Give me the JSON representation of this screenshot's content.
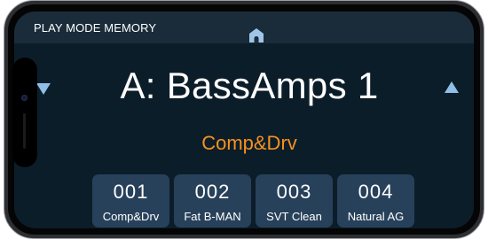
{
  "header": {
    "title": "PLAY MODE MEMORY",
    "home_icon": "home-icon"
  },
  "navigation": {
    "previous_icon": "triangle-down-icon",
    "next_icon": "triangle-up-icon",
    "arrow_color": "#8fbfe8"
  },
  "current_patch": {
    "name": "A: BassAmps 1",
    "subtitle": "Comp&Drv",
    "subtitle_color": "#f7921e"
  },
  "memory_slots": [
    {
      "number": "001",
      "label": "Comp&Drv"
    },
    {
      "number": "002",
      "label": "Fat B-MAN"
    },
    {
      "number": "003",
      "label": "SVT Clean"
    },
    {
      "number": "004",
      "label": "Natural AG"
    }
  ],
  "colors": {
    "background": "#0c1d2a",
    "header_bar": "#1a2c3a",
    "slot_background": "#27415a",
    "text": "#ffffff"
  }
}
